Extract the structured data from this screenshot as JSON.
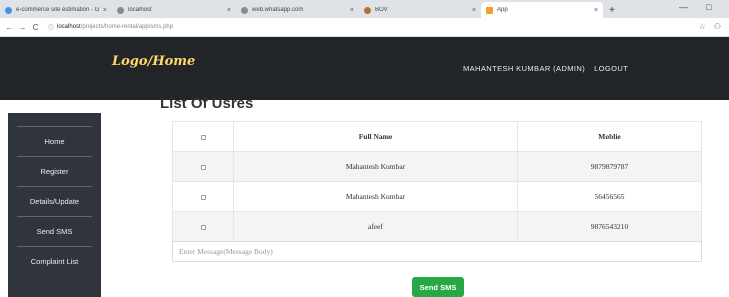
{
  "browser": {
    "tabs": [
      {
        "title": "e-commerce site estimation - Gr...",
        "favicon_color": "#4a90e2",
        "active": false
      },
      {
        "title": "localhost",
        "favicon_color": "#8a8a8a",
        "active": false
      },
      {
        "title": "web.whatsapp.com",
        "favicon_color": "#8a8a8a",
        "active": false
      },
      {
        "title": "BOV",
        "favicon_color": "#b07030",
        "active": false
      },
      {
        "title": "App",
        "favicon_color": "#f0a030",
        "active": true
      }
    ],
    "new_tab_glyph": "+",
    "tab_close_glyph": "×",
    "window_controls": {
      "minimize": "—",
      "maximize": "□"
    },
    "nav": {
      "back": "←",
      "forward": "→",
      "reload": "C"
    },
    "url_host": "localhost",
    "url_path": "/projects/home-rental/app/sms.php",
    "lock_glyph": "ⓘ",
    "star_glyph": "☆",
    "account_glyph": "⚇"
  },
  "header": {
    "logo": "Logo/Home",
    "user_label": "MAHANTESH KUMBAR (ADMIN)",
    "logout_label": "LOGOUT"
  },
  "sidebar": {
    "items": [
      {
        "label": "Home"
      },
      {
        "label": "Register"
      },
      {
        "label": "Details/Update"
      },
      {
        "label": "Send SMS"
      },
      {
        "label": "Complaint List"
      }
    ]
  },
  "main": {
    "title": "List Of Usres",
    "table": {
      "headers": [
        "",
        "Full Name",
        "Moblie"
      ],
      "rows": [
        {
          "name": "Mahantesh Kumbar",
          "mobile": "9879879787"
        },
        {
          "name": "Mahantesh Kumbar",
          "mobile": "56456565"
        },
        {
          "name": "afeef",
          "mobile": "9876543210"
        }
      ]
    },
    "message_placeholder": "Enter Message(Message Body)",
    "message_value": "",
    "send_label": "Send SMS"
  },
  "colors": {
    "header_bg": "#212529",
    "sidebar_bg": "#2f353b",
    "logo": "#ffd966",
    "send_button": "#28a745"
  }
}
